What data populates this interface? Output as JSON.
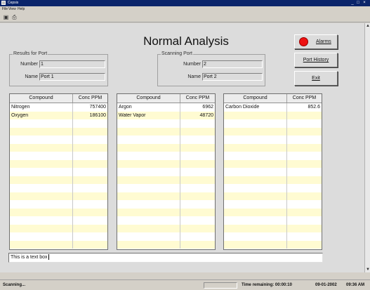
{
  "window": {
    "title": "Cepsis"
  },
  "menu": [
    "File",
    "View",
    "Help"
  ],
  "page_title": "Normal Analysis",
  "results_port": {
    "group_label": "Results for Port",
    "number_label": "Number",
    "number_value": "1",
    "name_label": "Name",
    "name_value": "Port 1"
  },
  "scanning_port": {
    "group_label": "Scanning Port",
    "number_label": "Number",
    "number_value": "2",
    "name_label": "Name",
    "name_value": "Port 2"
  },
  "buttons": {
    "alarms": "Alarms",
    "port_history": "Port History",
    "exit": "Exit"
  },
  "tables": [
    {
      "headers": [
        "Compound",
        "Conc PPM"
      ],
      "rows": [
        [
          "Nitrogen",
          "757400"
        ],
        [
          "Oxygen",
          "186100"
        ]
      ]
    },
    {
      "headers": [
        "Compound",
        "Conc PPM"
      ],
      "rows": [
        [
          "Argon",
          "6962"
        ],
        [
          "Water Vapor",
          "48720"
        ]
      ]
    },
    {
      "headers": [
        "Compound",
        "Conc PPM"
      ],
      "rows": [
        [
          "Carbon Dioxide",
          "852.6"
        ]
      ]
    }
  ],
  "textbox_value": "This is a text box",
  "status": {
    "left": "Scanning...",
    "time_remaining": "Time remaining: 00:00:10",
    "date": "09-01-2002",
    "time": "09:36 AM"
  },
  "colors": {
    "title_bar": "#0a246a",
    "row_stripe": "#fffbd2",
    "alarm": "#ee1111"
  }
}
